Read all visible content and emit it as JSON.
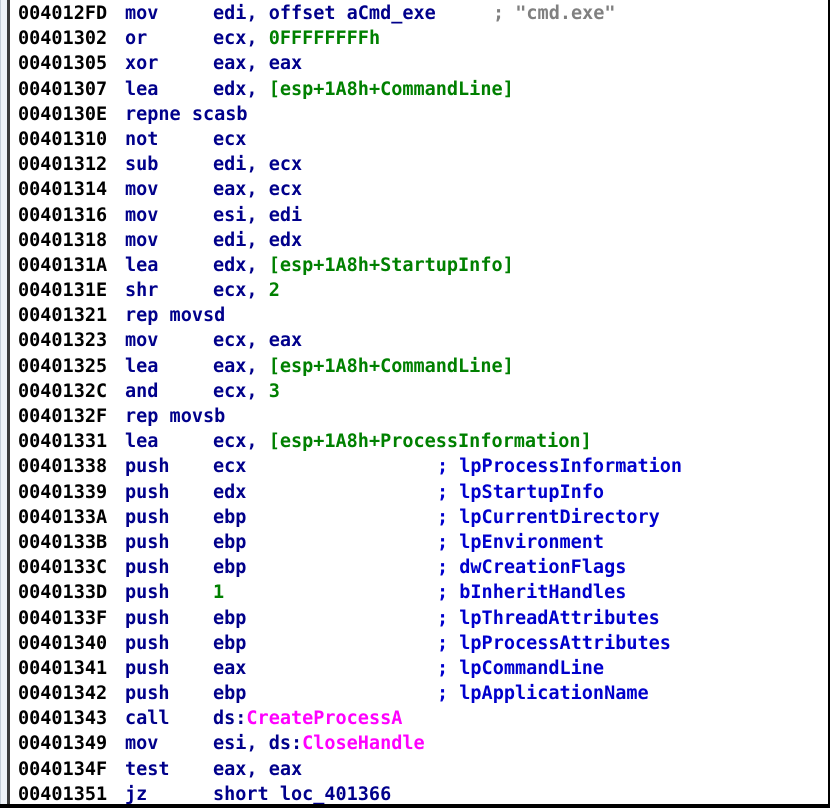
{
  "window": {
    "title": "IDA Pro disassembly view",
    "gutter_color": "#eef2f7",
    "background_color": "#ffffff",
    "colors": {
      "address": "#000000",
      "mnemonic": "#00008B",
      "register": "#00008B",
      "number": "#008000",
      "stack_variable": "#008000",
      "api_name": "#FF00FF",
      "argument_comment": "#0000CD",
      "string_comment": "#808080"
    }
  },
  "listing": {
    "lines": [
      {
        "address": "004012FD",
        "mnemonic": "mov",
        "operands": [
          {
            "text": "edi, offset ",
            "kind": "plain"
          },
          {
            "text": "aCmd_exe",
            "kind": "name"
          }
        ],
        "comment": "; \"cmd.exe\"",
        "comment_kind": "string",
        "comment_inline": true
      },
      {
        "address": "00401302",
        "mnemonic": "or",
        "operands": [
          {
            "text": "ecx, ",
            "kind": "reg"
          },
          {
            "text": "0FFFFFFFFh",
            "kind": "num"
          }
        ],
        "comment": "",
        "comment_kind": "none"
      },
      {
        "address": "00401305",
        "mnemonic": "xor",
        "operands": [
          {
            "text": "eax, eax",
            "kind": "reg"
          }
        ],
        "comment": "",
        "comment_kind": "none"
      },
      {
        "address": "00401307",
        "mnemonic": "lea",
        "operands": [
          {
            "text": "edx, ",
            "kind": "reg"
          },
          {
            "text": "[esp+1A8h+CommandLine]",
            "kind": "stack"
          }
        ],
        "comment": "",
        "comment_kind": "none"
      },
      {
        "address": "0040130E",
        "mnemonic": "repne scasb",
        "operands": [],
        "comment": "",
        "comment_kind": "none"
      },
      {
        "address": "00401310",
        "mnemonic": "not",
        "operands": [
          {
            "text": "ecx",
            "kind": "reg"
          }
        ],
        "comment": "",
        "comment_kind": "none"
      },
      {
        "address": "00401312",
        "mnemonic": "sub",
        "operands": [
          {
            "text": "edi, ecx",
            "kind": "reg"
          }
        ],
        "comment": "",
        "comment_kind": "none"
      },
      {
        "address": "00401314",
        "mnemonic": "mov",
        "operands": [
          {
            "text": "eax, ecx",
            "kind": "reg"
          }
        ],
        "comment": "",
        "comment_kind": "none"
      },
      {
        "address": "00401316",
        "mnemonic": "mov",
        "operands": [
          {
            "text": "esi, edi",
            "kind": "reg"
          }
        ],
        "comment": "",
        "comment_kind": "none"
      },
      {
        "address": "00401318",
        "mnemonic": "mov",
        "operands": [
          {
            "text": "edi, edx",
            "kind": "reg"
          }
        ],
        "comment": "",
        "comment_kind": "none"
      },
      {
        "address": "0040131A",
        "mnemonic": "lea",
        "operands": [
          {
            "text": "edx, ",
            "kind": "reg"
          },
          {
            "text": "[esp+1A8h+StartupInfo]",
            "kind": "stack"
          }
        ],
        "comment": "",
        "comment_kind": "none"
      },
      {
        "address": "0040131E",
        "mnemonic": "shr",
        "operands": [
          {
            "text": "ecx, ",
            "kind": "reg"
          },
          {
            "text": "2",
            "kind": "num"
          }
        ],
        "comment": "",
        "comment_kind": "none"
      },
      {
        "address": "00401321",
        "mnemonic": "rep movsd",
        "operands": [],
        "comment": "",
        "comment_kind": "none"
      },
      {
        "address": "00401323",
        "mnemonic": "mov",
        "operands": [
          {
            "text": "ecx, eax",
            "kind": "reg"
          }
        ],
        "comment": "",
        "comment_kind": "none"
      },
      {
        "address": "00401325",
        "mnemonic": "lea",
        "operands": [
          {
            "text": "eax, ",
            "kind": "reg"
          },
          {
            "text": "[esp+1A8h+CommandLine]",
            "kind": "stack"
          }
        ],
        "comment": "",
        "comment_kind": "none"
      },
      {
        "address": "0040132C",
        "mnemonic": "and",
        "operands": [
          {
            "text": "ecx, ",
            "kind": "reg"
          },
          {
            "text": "3",
            "kind": "num"
          }
        ],
        "comment": "",
        "comment_kind": "none"
      },
      {
        "address": "0040132F",
        "mnemonic": "rep movsb",
        "operands": [],
        "comment": "",
        "comment_kind": "none"
      },
      {
        "address": "00401331",
        "mnemonic": "lea",
        "operands": [
          {
            "text": "ecx, ",
            "kind": "reg"
          },
          {
            "text": "[esp+1A8h+ProcessInformation]",
            "kind": "stack"
          }
        ],
        "comment": "",
        "comment_kind": "none"
      },
      {
        "address": "00401338",
        "mnemonic": "push",
        "operands": [
          {
            "text": "ecx",
            "kind": "reg"
          }
        ],
        "comment": "; lpProcessInformation",
        "comment_kind": "arg"
      },
      {
        "address": "00401339",
        "mnemonic": "push",
        "operands": [
          {
            "text": "edx",
            "kind": "reg"
          }
        ],
        "comment": "; lpStartupInfo",
        "comment_kind": "arg"
      },
      {
        "address": "0040133A",
        "mnemonic": "push",
        "operands": [
          {
            "text": "ebp",
            "kind": "reg"
          }
        ],
        "comment": "; lpCurrentDirectory",
        "comment_kind": "arg"
      },
      {
        "address": "0040133B",
        "mnemonic": "push",
        "operands": [
          {
            "text": "ebp",
            "kind": "reg"
          }
        ],
        "comment": "; lpEnvironment",
        "comment_kind": "arg"
      },
      {
        "address": "0040133C",
        "mnemonic": "push",
        "operands": [
          {
            "text": "ebp",
            "kind": "reg"
          }
        ],
        "comment": "; dwCreationFlags",
        "comment_kind": "arg"
      },
      {
        "address": "0040133D",
        "mnemonic": "push",
        "operands": [
          {
            "text": "1",
            "kind": "num"
          }
        ],
        "comment": "; bInheritHandles",
        "comment_kind": "arg"
      },
      {
        "address": "0040133F",
        "mnemonic": "push",
        "operands": [
          {
            "text": "ebp",
            "kind": "reg"
          }
        ],
        "comment": "; lpThreadAttributes",
        "comment_kind": "arg"
      },
      {
        "address": "00401340",
        "mnemonic": "push",
        "operands": [
          {
            "text": "ebp",
            "kind": "reg"
          }
        ],
        "comment": "; lpProcessAttributes",
        "comment_kind": "arg"
      },
      {
        "address": "00401341",
        "mnemonic": "push",
        "operands": [
          {
            "text": "eax",
            "kind": "reg"
          }
        ],
        "comment": "; lpCommandLine",
        "comment_kind": "arg"
      },
      {
        "address": "00401342",
        "mnemonic": "push",
        "operands": [
          {
            "text": "ebp",
            "kind": "reg"
          }
        ],
        "comment": "; lpApplicationName",
        "comment_kind": "arg"
      },
      {
        "address": "00401343",
        "mnemonic": "call",
        "operands": [
          {
            "text": "ds:",
            "kind": "seg"
          },
          {
            "text": "CreateProcessA",
            "kind": "api"
          }
        ],
        "comment": "",
        "comment_kind": "none"
      },
      {
        "address": "00401349",
        "mnemonic": "mov",
        "operands": [
          {
            "text": "esi, ds:",
            "kind": "seg"
          },
          {
            "text": "CloseHandle",
            "kind": "api"
          }
        ],
        "comment": "",
        "comment_kind": "none"
      },
      {
        "address": "0040134F",
        "mnemonic": "test",
        "operands": [
          {
            "text": "eax, eax",
            "kind": "reg"
          }
        ],
        "comment": "",
        "comment_kind": "none"
      },
      {
        "address": "00401351",
        "mnemonic": "jz",
        "operands": [
          {
            "text": "short ",
            "kind": "plain"
          },
          {
            "text": "loc_401366",
            "kind": "loc"
          }
        ],
        "comment": "",
        "comment_kind": "none"
      }
    ]
  }
}
